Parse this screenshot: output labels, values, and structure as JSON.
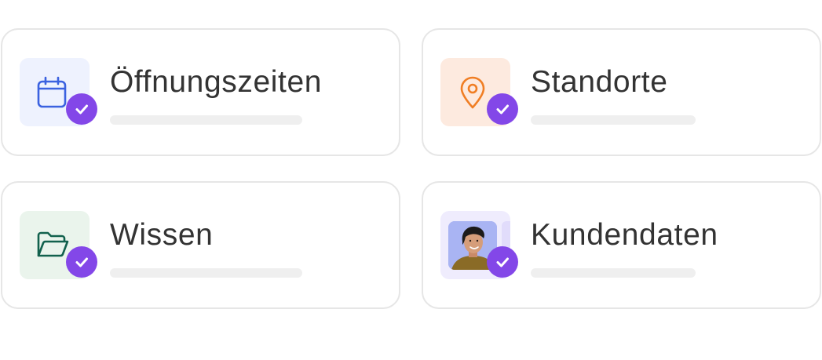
{
  "cards": [
    {
      "title": "Öffnungszeiten",
      "icon": "calendar-icon",
      "accent": "#3b62e0",
      "tile_color": "#eef2fe",
      "checked": true
    },
    {
      "title": "Standorte",
      "icon": "location-pin-icon",
      "accent": "#f07e24",
      "tile_color": "#fdeadf",
      "checked": true
    },
    {
      "title": "Wissen",
      "icon": "folder-icon",
      "accent": "#12614d",
      "tile_color": "#eaf4ec",
      "checked": true
    },
    {
      "title": "Kundendaten",
      "icon": "avatar-photo",
      "accent": "#8347e8",
      "tile_color": "#efecfd",
      "checked": true
    }
  ],
  "colors": {
    "check_badge": "#8347e8",
    "card_border": "#e6e6e6",
    "text": "#333333",
    "placeholder_bar": "#efefef"
  }
}
